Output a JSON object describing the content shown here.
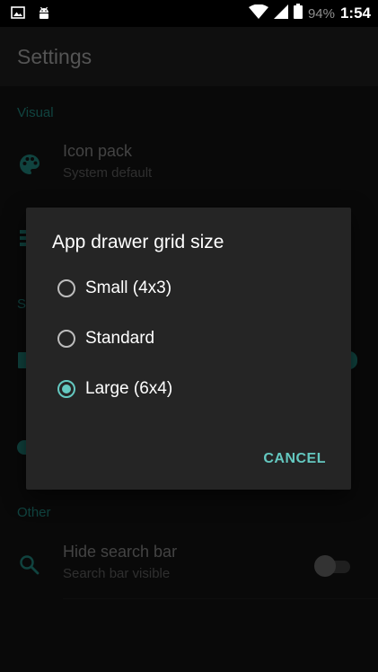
{
  "status_bar": {
    "battery_text": "94%",
    "time": "1:54",
    "icons": [
      "image-icon",
      "android-icon",
      "wifi-icon",
      "signal-icon",
      "battery-icon"
    ]
  },
  "app_bar": {
    "title": "Settings"
  },
  "sections": {
    "visual_header": "Visual",
    "s_header": "S",
    "other_header": "Other"
  },
  "items": {
    "icon_pack": {
      "title": "Icon pack",
      "summary": "System default",
      "icon": "palette-icon"
    },
    "hide_search": {
      "title": "Hide search bar",
      "summary": "Search bar visible",
      "icon": "search-icon",
      "toggle_on": false
    }
  },
  "dialog": {
    "title": "App drawer grid size",
    "options": [
      {
        "label": "Small (4x3)",
        "checked": false
      },
      {
        "label": "Standard",
        "checked": false
      },
      {
        "label": "Large (6x4)",
        "checked": true
      }
    ],
    "cancel_label": "CANCEL"
  },
  "colors": {
    "accent": "#64c8c0",
    "section_header": "#1e7a74",
    "dialog_bg": "#252525",
    "background": "#121212"
  }
}
